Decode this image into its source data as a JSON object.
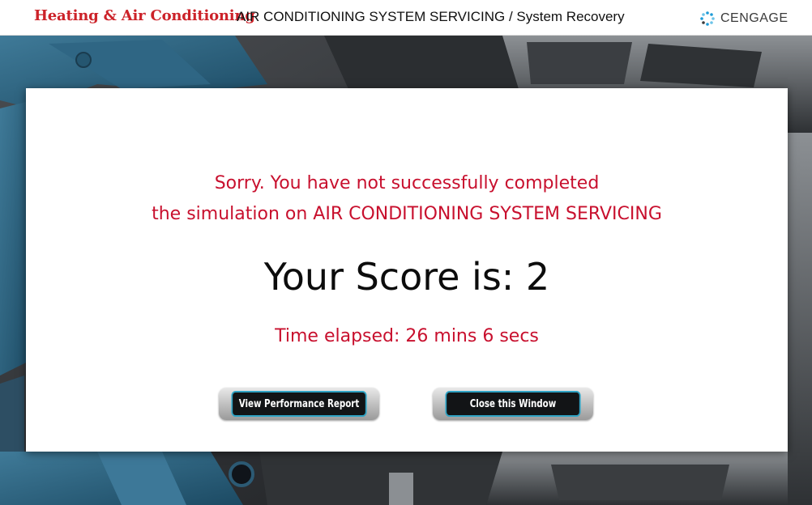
{
  "header": {
    "brand": "Heating & Air Conditioning",
    "module_title": "AIR CONDITIONING SYSTEM SERVICING / System Recovery",
    "logo_text": "CENGAGE",
    "brand_color": "#cc2229"
  },
  "dialog": {
    "message_line1": "Sorry. You have not successfully completed",
    "message_line2": "the simulation on AIR CONDITIONING SYSTEM SERVICING",
    "score_text": "Your Score is: 2",
    "time_text": "Time elapsed: 26 mins 6 secs",
    "message_color": "#c8102e",
    "buttons": {
      "view_report": "View Performance Report",
      "close_window": "Close this Window"
    },
    "button_accent": "#2fa3c4"
  }
}
